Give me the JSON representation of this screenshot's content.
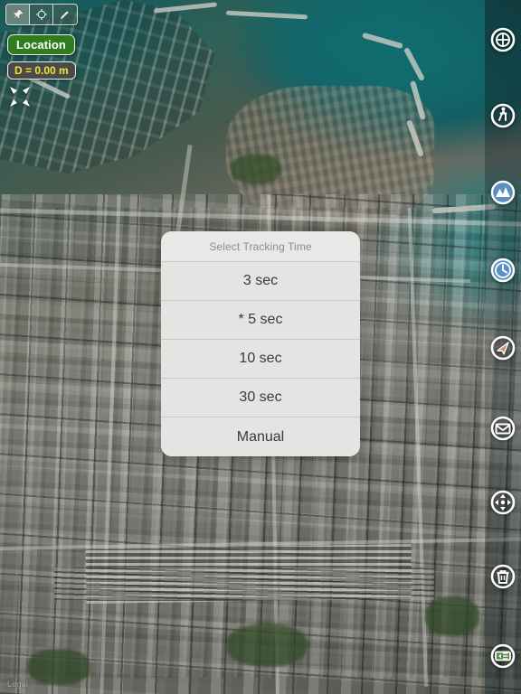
{
  "app": {
    "type": "satellite-map-tracking-app",
    "attribution": "Legal"
  },
  "toolbar": {
    "buttons": [
      {
        "name": "pin-tool",
        "icon": "pin-icon",
        "label": "Pin",
        "active": true
      },
      {
        "name": "target-tool",
        "icon": "crosshair-icon",
        "label": "Target",
        "active": false
      },
      {
        "name": "draw-tool",
        "icon": "pencil-icon",
        "label": "Draw",
        "active": false
      }
    ]
  },
  "status": {
    "location_label": "Location",
    "location_bg": "#2f7d1f",
    "location_color": "#ffffff",
    "distance_label": "D = 0.00 m",
    "distance_color": "#f0e832",
    "distance_bg": "#4a4a4a",
    "expand_icon": "expand-arrows-icon"
  },
  "sidebar": {
    "items": [
      {
        "name": "settings-wheel-button",
        "icon": "compass-wheel-icon",
        "style": "dark"
      },
      {
        "name": "pedestrian-mode-button",
        "icon": "walking-person-icon",
        "style": "dark"
      },
      {
        "name": "elevation-button",
        "icon": "mountains-icon",
        "style": "blue"
      },
      {
        "name": "tracking-time-button",
        "icon": "clock-icon",
        "style": "blue"
      },
      {
        "name": "compass-button",
        "icon": "navigation-arrow-icon",
        "style": "dark"
      },
      {
        "name": "mail-button",
        "icon": "envelope-icon",
        "style": "dark"
      },
      {
        "name": "pan-button",
        "icon": "move-arrows-icon",
        "style": "dark"
      },
      {
        "name": "delete-button",
        "icon": "trash-icon",
        "style": "dark"
      },
      {
        "name": "collapse-panel-button",
        "icon": "collapse-left-icon",
        "style": "green"
      }
    ]
  },
  "dialog": {
    "title": "Select Tracking Time",
    "options": [
      {
        "label": "3 sec",
        "selected": false
      },
      {
        "label": "* 5 sec",
        "selected": true
      },
      {
        "label": "10 sec",
        "selected": false
      },
      {
        "label": "30 sec",
        "selected": false
      },
      {
        "label": "Manual",
        "selected": false
      }
    ]
  }
}
